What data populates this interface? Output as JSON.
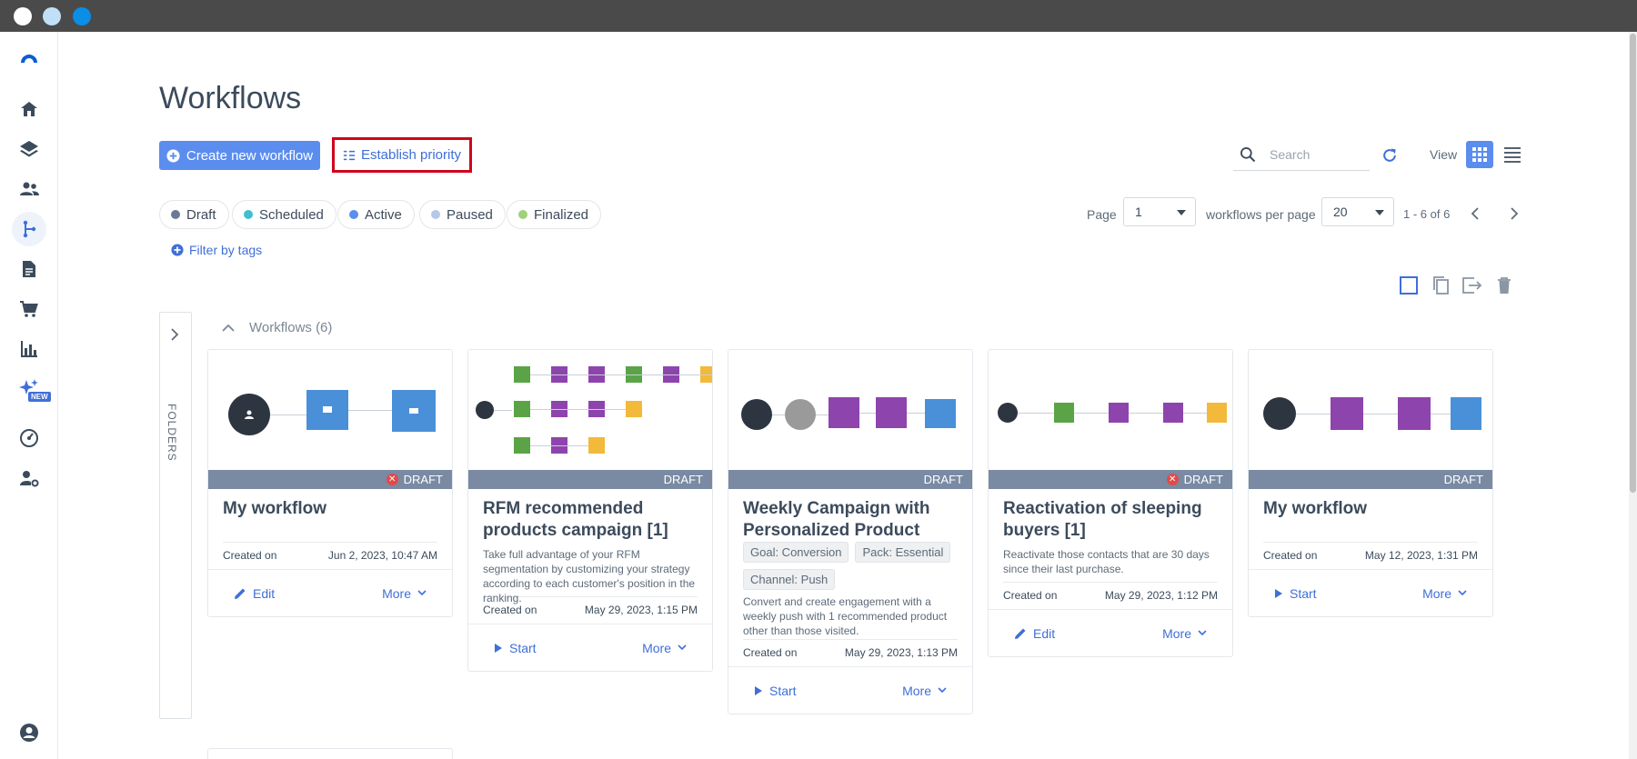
{
  "window": {
    "controls": [
      "close",
      "minimize",
      "maximize"
    ],
    "colors": [
      "#ffffff",
      "#bfe0f7",
      "#0a8ee6"
    ]
  },
  "sidebar": {
    "items": [
      {
        "name": "logo",
        "icon": "logo-icon"
      },
      {
        "name": "home",
        "icon": "home-icon"
      },
      {
        "name": "campaigns",
        "icon": "layers-icon"
      },
      {
        "name": "contacts",
        "icon": "users-icon"
      },
      {
        "name": "automation",
        "icon": "workflow-icon",
        "active": true
      },
      {
        "name": "templates",
        "icon": "document-icon"
      },
      {
        "name": "ecommerce",
        "icon": "cart-icon"
      },
      {
        "name": "reports",
        "icon": "chart-icon"
      },
      {
        "name": "ai",
        "icon": "sparkle-icon",
        "badge": "NEW"
      },
      {
        "name": "dashboard",
        "icon": "gauge-icon"
      },
      {
        "name": "user-settings",
        "icon": "user-gear-icon"
      },
      {
        "name": "account",
        "icon": "account-icon"
      }
    ]
  },
  "header": {
    "title": "Workflows",
    "create_label": "Create new workflow",
    "priority_label": "Establish priority",
    "search_placeholder": "Search",
    "view_label": "View"
  },
  "filters": {
    "statuses": [
      {
        "label": "Draft",
        "color": "#6b7a94"
      },
      {
        "label": "Scheduled",
        "color": "#3fbfd0"
      },
      {
        "label": "Active",
        "color": "#5b8def"
      },
      {
        "label": "Paused",
        "color": "#b6c8ea"
      },
      {
        "label": "Finalized",
        "color": "#9ed17b"
      }
    ],
    "tags_label": "Filter by tags"
  },
  "pagination": {
    "page_label": "Page",
    "page_value": "1",
    "per_page_label": "workflows per page",
    "per_page_value": "20",
    "range": "1 - 6 of 6"
  },
  "folders": {
    "label": "FOLDERS"
  },
  "section": {
    "title": "Workflows (6)"
  },
  "cards": [
    {
      "status": "DRAFT",
      "error": true,
      "title": "My workflow",
      "created_label": "Created on",
      "created_date": "Jun 2, 2023, 10:47 AM",
      "primary_action": "Edit",
      "more_label": "More"
    },
    {
      "status": "DRAFT",
      "error": false,
      "title": "RFM recommended products campaign [1]",
      "description": "Take full advantage of your RFM segmentation by customizing your strategy according to each customer's position in the ranking.",
      "created_label": "Created on",
      "created_date": "May 29, 2023, 1:15 PM",
      "primary_action": "Start",
      "more_label": "More"
    },
    {
      "status": "DRAFT",
      "error": false,
      "title": "Weekly Campaign with Personalized Product",
      "tags": [
        "Goal: Conversion",
        "Pack: Essential",
        "Channel: Push"
      ],
      "description": "Convert and create engagement with a weekly push with 1 recommended product other than those visited.",
      "created_label": "Created on",
      "created_date": "May 29, 2023, 1:13 PM",
      "primary_action": "Start",
      "more_label": "More"
    },
    {
      "status": "DRAFT",
      "error": true,
      "title": "Reactivation of sleeping buyers [1]",
      "description": "Reactivate those contacts that are 30 days since their last purchase.",
      "created_label": "Created on",
      "created_date": "May 29, 2023, 1:12 PM",
      "primary_action": "Edit",
      "more_label": "More"
    },
    {
      "status": "DRAFT",
      "error": false,
      "title": "My workflow",
      "created_label": "Created on",
      "created_date": "May 12, 2023, 1:31 PM",
      "primary_action": "Start",
      "more_label": "More"
    }
  ],
  "colors": {
    "accent": "#5b8def",
    "link": "#3f6fd8",
    "highlight": "#d0021b",
    "node_purple": "#8e44ad",
    "node_green": "#5aa447",
    "node_blue": "#4a90d9",
    "node_yellow": "#f3b93a",
    "node_dark": "#2d3540"
  }
}
